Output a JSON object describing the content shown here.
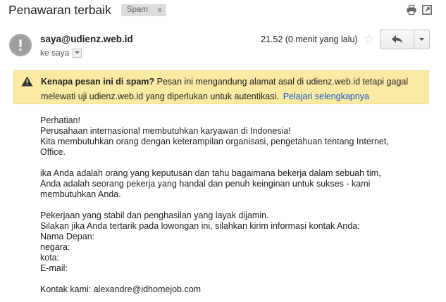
{
  "subject": "Penawaran terbaik",
  "label_chip": {
    "label": "Spam",
    "remove": "x"
  },
  "toolbar_icons": [
    "print-icon",
    "open-new-window-icon"
  ],
  "sender": "saya@udienz.web.id",
  "recipient": "ke saya",
  "time": "21.52 (0 menit yang lalu)",
  "star_icon": "star-icon",
  "reply_icon": "reply-icon",
  "more_icon": "chevron-down-icon",
  "spam_warning": {
    "question": "Kenapa pesan ini di spam?",
    "line1": "Pesan ini mengandung alamat asal di udienz.web.id tetapi gagal",
    "line2": "melewati uji udienz.web.id yang diperlukan untuk autentikasi.",
    "learn_more": "Pelajari selengkapnya",
    "bg_color": "#fbeaa4"
  },
  "body": {
    "p1": [
      "Perhatian!",
      "Perusahaan internasional membutuhkan karyawan di Indonesia!",
      "Kita membutuhkan orang dengan keterampilan organisasi, pengetahuan tentang Internet,",
      "Office."
    ],
    "p2": [
      "ika Anda adalah orang yang keputusan dan tahu bagaimana bekerja dalam sebuah tim,",
      "Anda adalah seorang pekerja yang handal dan penuh keinginan untuk sukses - kami",
      "membutuhkan Anda."
    ],
    "p3": [
      "Pekerjaan yang stabil dan penghasilan yang layak dijamin.",
      "Silakan jika Anda tertarik pada lowongan ini, silahkan kirim informasi kontak Anda:",
      "Nama Depan:",
      "negara:",
      "kota:",
      "E-mail:"
    ],
    "p4": [
      "Kontak kami: alexandre@idhomejob.com"
    ]
  },
  "link_color": "#1155cc"
}
